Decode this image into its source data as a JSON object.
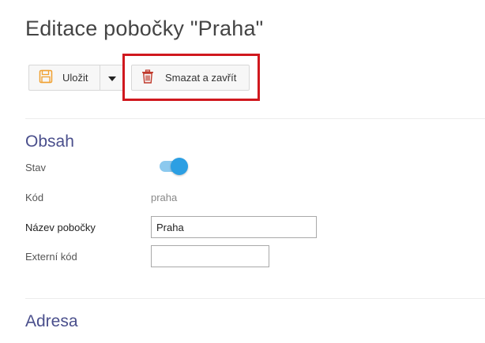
{
  "page": {
    "title": "Editace pobočky \"Praha\""
  },
  "toolbar": {
    "save_label": "Uložit",
    "save_icon": "floppy-disk-icon",
    "dropdown_icon": "caret-down-icon",
    "delete_label": "Smazat a zavřít",
    "delete_icon": "trash-icon",
    "highlight_color": "#d0181e"
  },
  "sections": {
    "content": {
      "title": "Obsah",
      "status_label": "Stav",
      "status_on": true,
      "code_label": "Kód",
      "code_value": "praha",
      "name_label": "Název pobočky",
      "name_value": "Praha",
      "external_code_label": "Externí kód",
      "external_code_value": ""
    },
    "address": {
      "title": "Adresa"
    }
  },
  "colors": {
    "accent": "#2c9fe3",
    "section_title": "#4a4f8c",
    "save_icon": "#f0a030",
    "delete_icon": "#c0392b"
  }
}
